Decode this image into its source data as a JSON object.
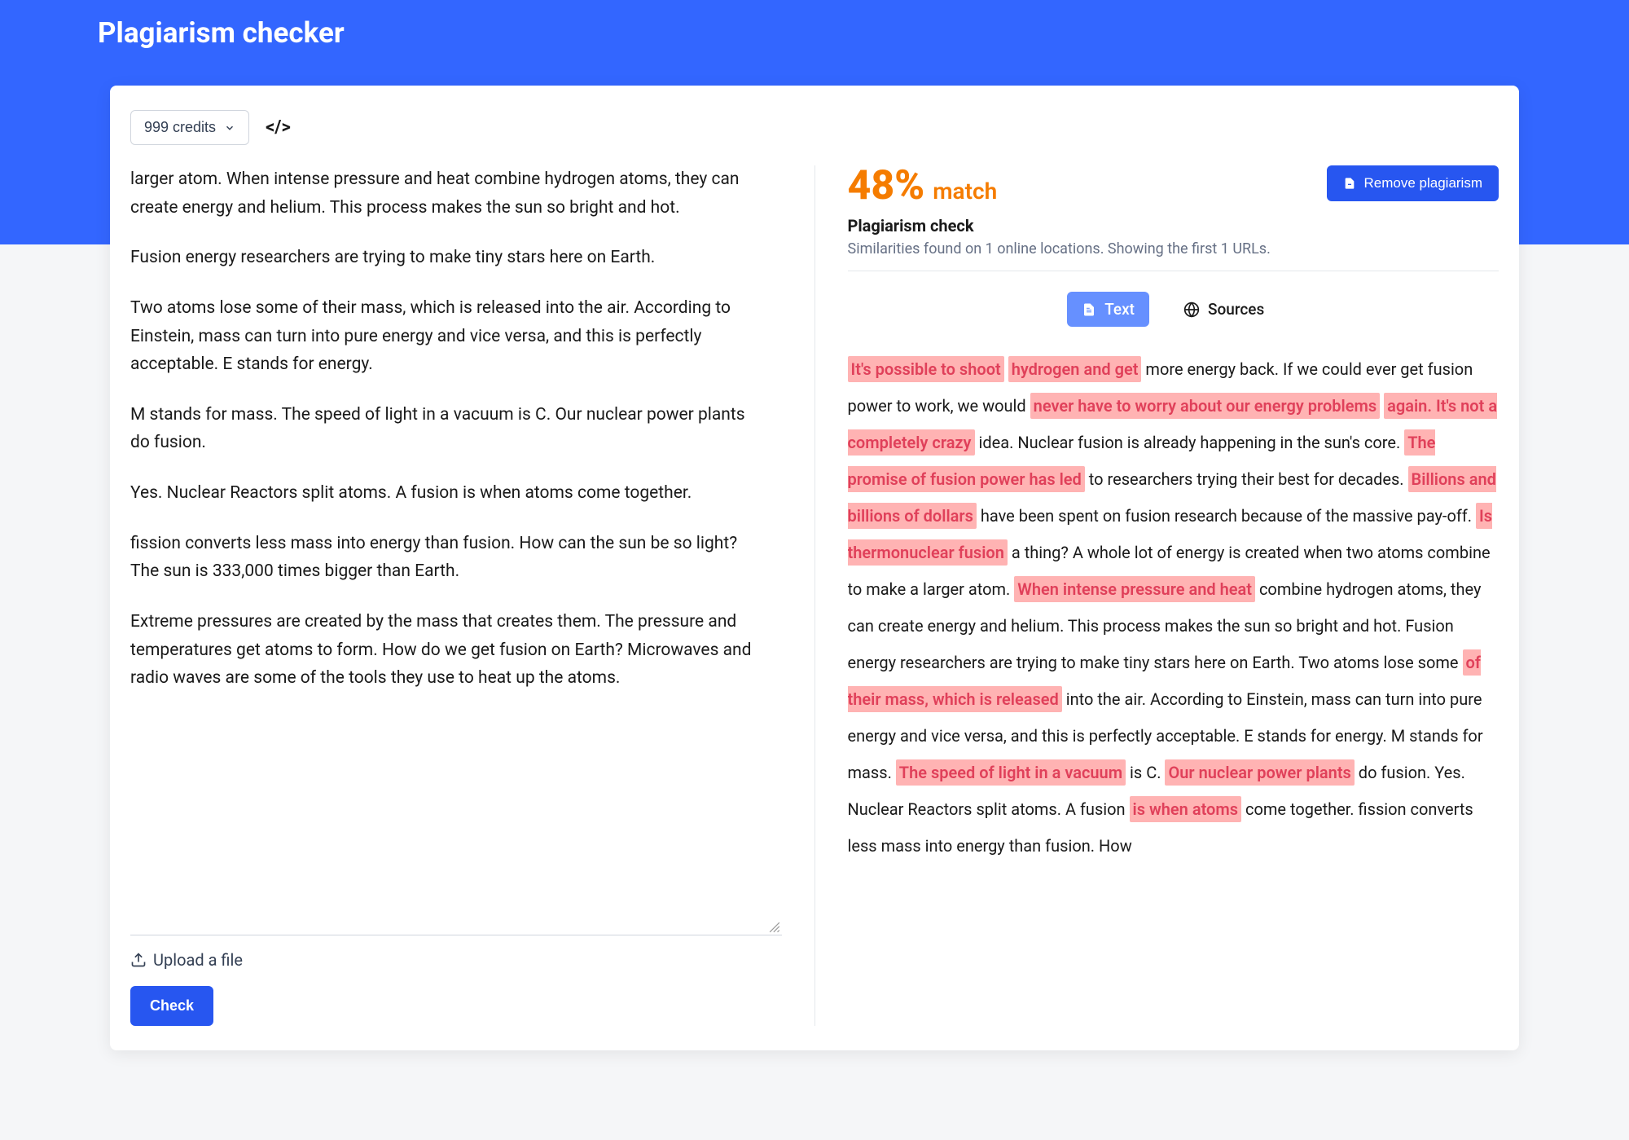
{
  "page": {
    "title": "Plagiarism checker"
  },
  "toolbar": {
    "credits_label": "999 credits"
  },
  "input": {
    "paragraphs": [
      "larger atom. When intense pressure and heat combine hydrogen atoms, they can create energy and helium. This process makes the sun so bright and hot.",
      "Fusion energy researchers are trying to make tiny stars here on Earth.",
      "Two atoms lose some of their mass, which is released into the air. According to Einstein, mass can turn into pure energy and vice versa, and this is perfectly acceptable. E stands for energy.",
      "M stands for mass. The speed of light in a vacuum is C. Our nuclear power plants do fusion.",
      "Yes. Nuclear Reactors split atoms. A fusion is when atoms come together.",
      "fission converts less mass into energy than fusion. How can the sun be so light? The sun is 333,000 times bigger than Earth.",
      "Extreme pressures are created by the mass that creates them. The pressure and temperatures get atoms to form. How do we get fusion on Earth? Microwaves and radio waves are some of the tools they use to heat up the atoms."
    ],
    "upload_label": "Upload a file",
    "check_label": "Check"
  },
  "result": {
    "percent": "48%",
    "match_label": "match",
    "remove_label": "Remove plagiarism",
    "check_title": "Plagiarism check",
    "check_subtitle": "Similarities found on 1 online locations. Showing the first 1 URLs.",
    "tabs": {
      "text": "Text",
      "sources": "Sources"
    },
    "segments": [
      {
        "t": "It's possible to shoot",
        "h": true
      },
      {
        "t": " ",
        "h": false
      },
      {
        "t": "hydrogen and get",
        "h": true
      },
      {
        "t": " more energy back. If we could ever get fusion power to work, we would ",
        "h": false
      },
      {
        "t": "never have to worry about our energy problems",
        "h": true
      },
      {
        "t": " ",
        "h": false
      },
      {
        "t": "again. It's not a completely crazy",
        "h": true
      },
      {
        "t": " idea. Nuclear fusion is already happening in the sun's core. ",
        "h": false
      },
      {
        "t": "The promise of fusion power has led",
        "h": true
      },
      {
        "t": " to researchers trying their best for decades. ",
        "h": false
      },
      {
        "t": "Billions and billions of dollars",
        "h": true
      },
      {
        "t": " have been spent on fusion research because of the massive pay-off. ",
        "h": false
      },
      {
        "t": "Is thermonuclear fusion",
        "h": true
      },
      {
        "t": " a thing? A whole lot of energy is created when two atoms combine to make a larger atom. ",
        "h": false
      },
      {
        "t": "When intense pressure and heat",
        "h": true
      },
      {
        "t": " combine hydrogen atoms, they can create energy and helium. This process makes the sun so bright and hot. Fusion energy researchers are trying to make tiny stars here on Earth. Two atoms lose some ",
        "h": false
      },
      {
        "t": "of their mass, which is released",
        "h": true
      },
      {
        "t": " into the air. According to Einstein, mass can turn into pure energy and vice versa, and this is perfectly acceptable. E stands for energy. M stands for mass. ",
        "h": false
      },
      {
        "t": "The speed of light in a vacuum",
        "h": true
      },
      {
        "t": " is C. ",
        "h": false
      },
      {
        "t": "Our nuclear power plants",
        "h": true
      },
      {
        "t": " do fusion. Yes. Nuclear Reactors split atoms. A fusion ",
        "h": false
      },
      {
        "t": "is when atoms",
        "h": true
      },
      {
        "t": " come together. fission converts less mass into energy than fusion. How",
        "h": false
      }
    ]
  }
}
